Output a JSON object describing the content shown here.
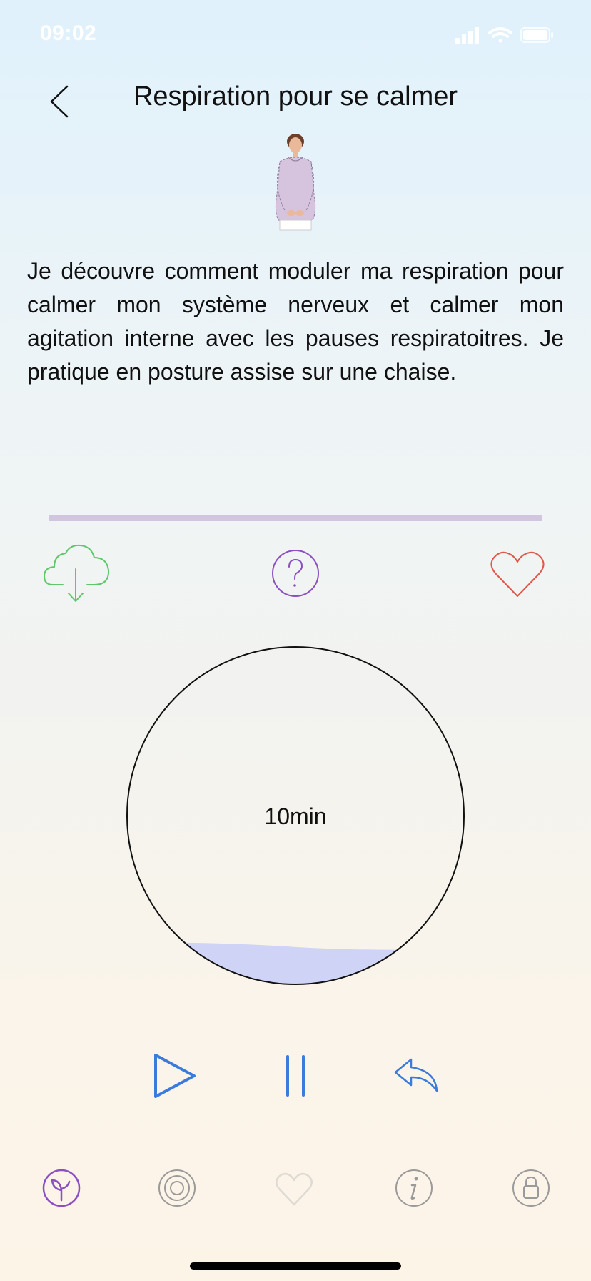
{
  "status_bar": {
    "time": "09:02"
  },
  "header": {
    "title": "Respiration pour se calmer"
  },
  "description": "Je découvre comment moduler ma respiration pour calmer mon système nerveux et calmer mon agitation interne avec les pauses respiratoitres. Je pratique en posture assise sur une chaise.",
  "progress": {
    "fraction": 0.0
  },
  "actions": {
    "download_icon": "cloud-download-icon",
    "help_icon": "question-icon",
    "favorite_icon": "heart-icon"
  },
  "timer": {
    "label": "10min"
  },
  "controls": {
    "play_icon": "play-icon",
    "pause_icon": "pause-icon",
    "replay_icon": "replay-icon"
  },
  "tab_bar": {
    "items": [
      {
        "icon": "sprout-icon",
        "active": true
      },
      {
        "icon": "target-icon",
        "active": false
      },
      {
        "icon": "heart-icon",
        "active": false
      },
      {
        "icon": "info-icon",
        "active": false
      },
      {
        "icon": "lock-icon",
        "active": false
      }
    ]
  },
  "colors": {
    "accent_purple": "#8a4fc0",
    "download_green": "#5cc86a",
    "heart_red": "#e0584a",
    "control_blue": "#3a7bdc",
    "progress_track": "#d1c5e0",
    "timer_fill": "#cfd3f6"
  }
}
